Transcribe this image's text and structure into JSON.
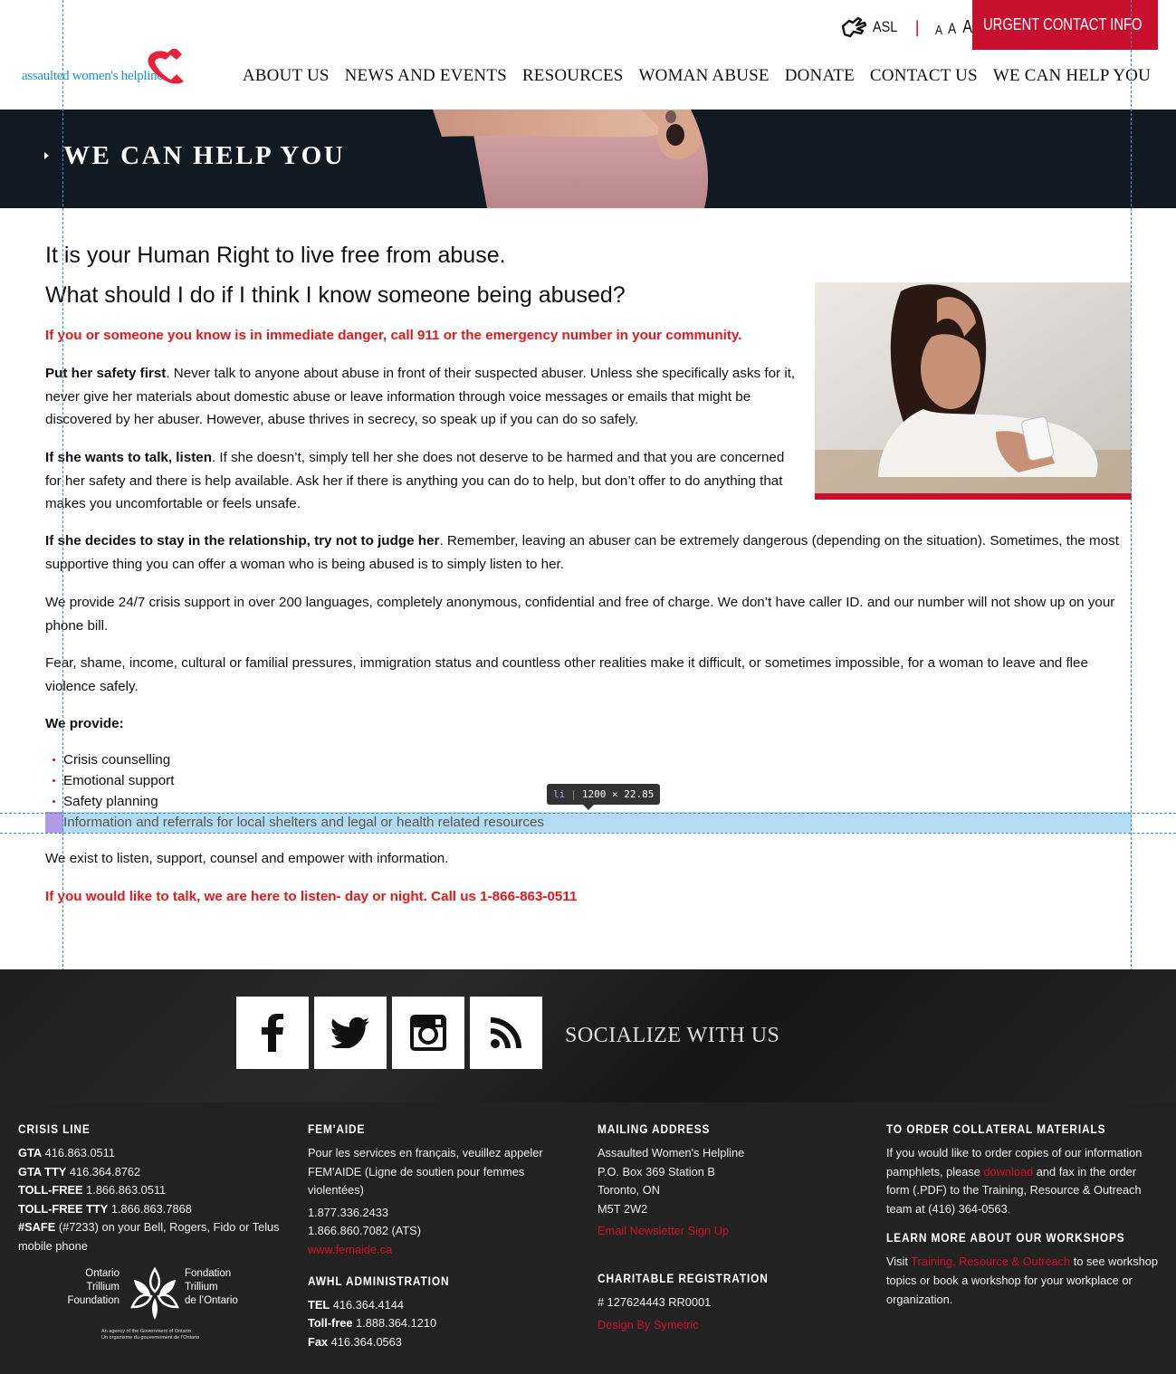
{
  "header": {
    "logo_text": "assaulted women's helpline",
    "asl_label": "ASL",
    "separator": "|",
    "text_size": [
      "A",
      "A",
      "A"
    ],
    "urgent_label": "URGENT CONTACT INFO",
    "nav": [
      "ABOUT US",
      "NEWS AND EVENTS",
      "RESOURCES",
      "WOMAN ABUSE",
      "DONATE",
      "CONTACT US",
      "WE CAN HELP YOU"
    ]
  },
  "banner": {
    "title": "WE CAN HELP YOU"
  },
  "content": {
    "heading1": "It is your Human Right to live free from abuse.",
    "heading2": "What should I do if I think I know someone being abused?",
    "alert_top": "If you or someone you know is in immediate danger, call 911 or the emergency number in your community.",
    "p1_bold": "Put her safety first",
    "p1_text": ". Never talk to anyone about abuse in front of their suspected abuser. Unless she specifically asks for it, never give her materials about domestic abuse or leave information through voice messages or emails that might be discovered by her abuser. However, abuse thrives in secrecy, so speak up if you can do so safely.",
    "p2_bold": "If she wants to talk, listen",
    "p2_text": ". If she doesn’t, simply tell her she does not deserve to be harmed and that you are concerned for her safety and there is help available. Ask her if there is anything you can do to help, but don’t offer to do anything that makes you uncomfortable or feels unsafe.",
    "p3_bold": "If she decides to stay in the relationship, try not to judge her",
    "p3_text": ". Remember, leaving an abuser can be extremely dangerous (depending on the situation). Sometimes, the most supportive thing you can offer a woman who is being abused is to simply listen to her.",
    "p4": "We provide 24/7 crisis support in over 200 languages, completely anonymous, confidential and free of charge. We don’t have caller ID. and our number will not show up on your phone bill.",
    "p5": "Fear, shame, income, cultural or familial pressures, immigration status and countless other realities make it difficult, or sometimes impossible, for a woman to leave and flee violence safely.",
    "provide_label": "We provide:",
    "provide_items": [
      "Crisis counselling",
      "Emotional support",
      "Safety planning",
      "Information and referrals for local shelters and legal or health related resources"
    ],
    "p6": "We exist to listen, support, counsel and empower with information.",
    "alert_bottom": "If you would like to talk, we are here to listen- day or night. Call us 1-866-863-0511"
  },
  "devtools": {
    "tag": "li",
    "size": "1200 × 22.85"
  },
  "social": {
    "title": "SOCIALIZE WITH US",
    "icons": [
      "facebook-icon",
      "twitter-icon",
      "instagram-icon",
      "rss-icon"
    ]
  },
  "footer": {
    "crisis": {
      "title": "CRISIS LINE",
      "gta_label": "GTA",
      "gta": "416.863.0511",
      "gta_tty_label": "GTA TTY",
      "gta_tty": "416.364.8762",
      "tollfree_label": "TOLL-FREE",
      "tollfree": "1.866.863.0511",
      "tollfree_tty_label": "TOLL-FREE TTY",
      "tollfree_tty": "1.866.863.7868",
      "safe_label": "#SAFE",
      "safe_text": "(#7233) on your Bell, Rogers, Fido or Telus mobile phone"
    },
    "trillium": {
      "en": "Ontario\nTrillium\nFoundation",
      "fr": "Fondation\nTrillium\nde l’Ontario",
      "agency": "An agency of the Government of Ontario\nUn organisme du gouvernement de l’Ontario"
    },
    "femaide": {
      "title": "FEM'AIDE",
      "text": "Pour les services en français, veuillez appeler FEM'AIDE (Ligne de soutien pour femmes violentées)",
      "phone1": "1.877.336.2433",
      "phone2": "1.866.860.7082 (ATS)",
      "link": "www.femaide.ca"
    },
    "admin": {
      "title": "AWHL ADMINISTRATION",
      "tel_label": "TEL",
      "tel": "416.364.4144",
      "tollfree_label": "Toll-free",
      "tollfree": "1.888.364.1210",
      "fax_label": "Fax",
      "fax": "416.364.0563"
    },
    "mailing": {
      "title": "MAILING ADDRESS",
      "line1": "Assaulted Women's Helpline",
      "line2": "P.O. Box 369 Station B",
      "line3": "Toronto, ON",
      "line4": "M5T 2W2",
      "newsletter": "Email Newsletter Sign Up"
    },
    "charitable": {
      "title": "CHARITABLE REGISTRATION",
      "number": "# 127624443 RR0001",
      "design": "Design By Symetric"
    },
    "collateral": {
      "title": "TO ORDER COLLATERAL MATERIALS",
      "text_before": "If you would like to order copies of our information pamphlets, please",
      "link": "download",
      "text_after": "and fax in the order form (.PDF) to the Training, Resource & Outreach team at (416) 364-0563."
    },
    "workshops": {
      "title": "LEARN MORE ABOUT OUR WORKSHOPS",
      "text_before": "Visit",
      "link": "Training, Resource & Outreach",
      "text_after": "to see workshop topics or book a workshop for your workplace or organization."
    }
  }
}
